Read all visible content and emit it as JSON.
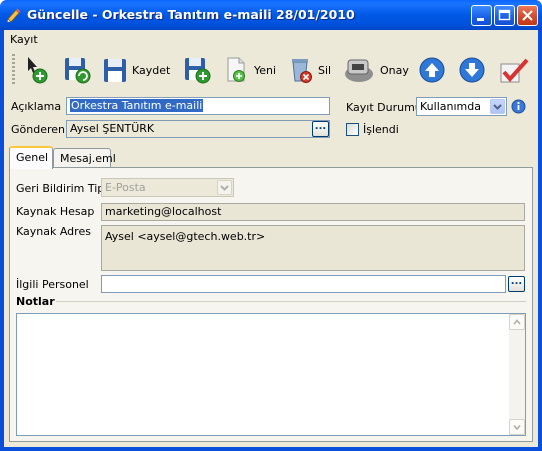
{
  "window": {
    "title": "Güncelle - Orkestra Tanıtım e-maili 28/01/2010",
    "controls": {
      "minimize": "minimize-icon",
      "maximize": "maximize-icon",
      "close": "close-icon"
    }
  },
  "menu": {
    "items": [
      {
        "label": "Kayıt"
      }
    ]
  },
  "toolbar": {
    "buttons": [
      {
        "id": "new",
        "icon": "new-record-icon",
        "label": ""
      },
      {
        "id": "save-new",
        "icon": "save-refresh-icon",
        "label": ""
      },
      {
        "id": "save",
        "icon": "save-icon",
        "label": "Kaydet"
      },
      {
        "id": "save-add",
        "icon": "save-add-icon",
        "label": ""
      },
      {
        "id": "new-doc",
        "icon": "new-document-icon",
        "label": "Yeni"
      },
      {
        "id": "delete",
        "icon": "delete-icon",
        "label": "Sil"
      },
      {
        "id": "approve",
        "icon": "approve-icon",
        "label": "Onay"
      },
      {
        "id": "up",
        "icon": "arrow-up-icon",
        "label": ""
      },
      {
        "id": "down",
        "icon": "arrow-down-icon",
        "label": ""
      },
      {
        "id": "check",
        "icon": "checkmark-icon",
        "label": ""
      }
    ]
  },
  "header": {
    "aciklama_label": "Açıklama",
    "aciklama_value": "Orkestra Tanıtım e-maili",
    "gonderen_label": "Gönderen",
    "gonderen_value": "Aysel ŞENTÜRK",
    "kayit_durumu_label": "Kayıt Durumu",
    "kayit_durumu_value": "Kullanımda",
    "islendi_label": "İşlendi",
    "islendi_checked": false
  },
  "tabs": [
    {
      "label": "Genel",
      "active": true
    },
    {
      "label": "Mesaj.eml",
      "active": false
    }
  ],
  "genel": {
    "geri_bildirim_label": "Geri Bildirim Tipi",
    "geri_bildirim_value": "E-Posta",
    "kaynak_hesap_label": "Kaynak Hesap",
    "kaynak_hesap_value": "marketing@localhost",
    "kaynak_adres_label": "Kaynak Adres",
    "kaynak_adres_value": "Aysel <aysel@gtech.web.tr>",
    "ilgili_personel_label": "İlgili Personel",
    "ilgili_personel_value": "",
    "notlar_label": "Notlar",
    "notlar_value": ""
  },
  "ellipsis_text": "...",
  "colors": {
    "title_bar": "#0058e6",
    "client_bg": "#ece9d8",
    "tab_accent": "#ffc83c",
    "selection": "#316ac5"
  }
}
